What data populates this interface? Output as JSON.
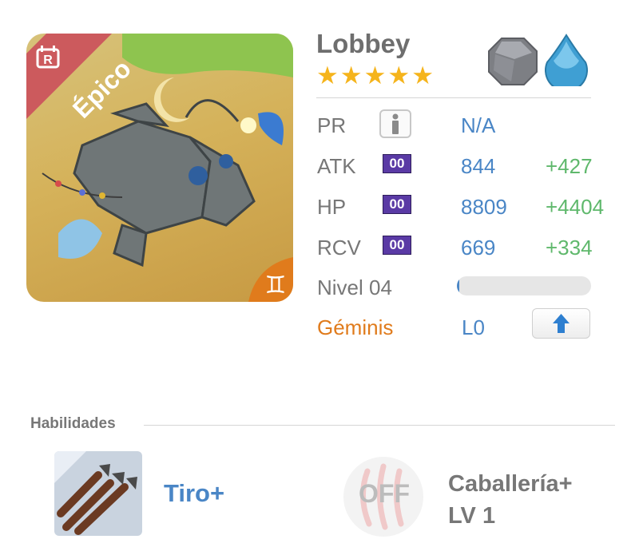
{
  "monster": {
    "name": "Lobbey",
    "rarity": "Épico",
    "rarity_tag": "R",
    "stars": 5,
    "elements": [
      "rock-element-icon",
      "water-element-icon"
    ],
    "zodiac_symbol": "♊"
  },
  "stats": {
    "pr": {
      "label": "PR",
      "value": "N/A"
    },
    "atk": {
      "label": "ATK",
      "plus": "00",
      "value": "844",
      "bonus": "+427"
    },
    "hp": {
      "label": "HP",
      "plus": "00",
      "value": "8809",
      "bonus": "+4404"
    },
    "rcv": {
      "label": "RCV",
      "plus": "00",
      "value": "669",
      "bonus": "+334"
    },
    "level": {
      "label": "Nivel 04",
      "progress": 0.02
    },
    "zodiac": {
      "label": "Géminis",
      "value": "L0"
    }
  },
  "skills": {
    "title": "Habilidades",
    "active": {
      "name": "Tiro+"
    },
    "leader": {
      "status": "OFF",
      "name": "Caballería+",
      "level": "LV 1"
    }
  },
  "colors": {
    "accent_blue": "#4a86c6",
    "bonus_green": "#5fb86c",
    "star_gold": "#f5b41c",
    "ribbon_red": "#cc5a5d",
    "zodiac_orange": "#e07b1c",
    "plus_purple": "#5a3aa5"
  }
}
